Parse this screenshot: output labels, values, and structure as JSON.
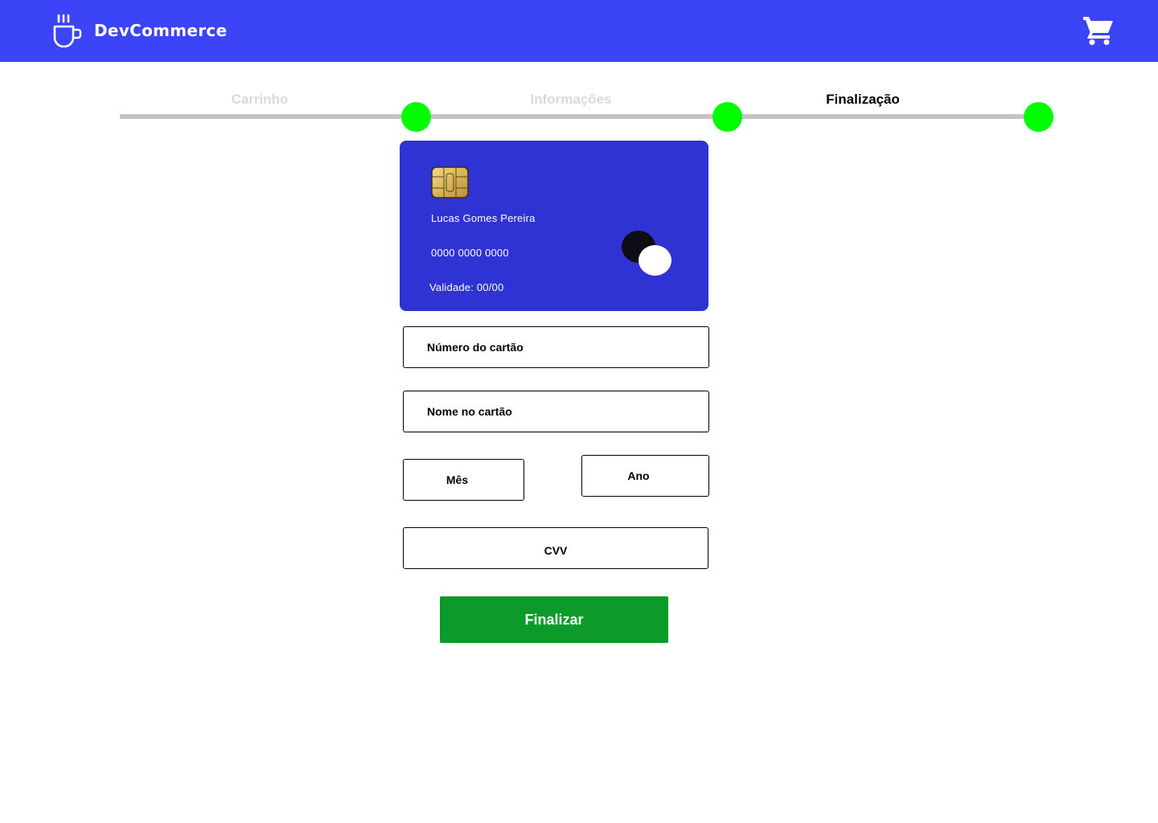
{
  "header": {
    "brand_name": "DevCommerce",
    "logo_icon": "coffee-cup-icon",
    "cart_icon": "shopping-cart-icon",
    "background_color": "#3c44f8"
  },
  "progress": {
    "steps": [
      {
        "label": "Carrinho",
        "state": "done"
      },
      {
        "label": "Informações",
        "state": "done"
      },
      {
        "label": "Finalização",
        "state": "current"
      }
    ],
    "dot_color": "#00ff00",
    "track_color": "#c4c4c4"
  },
  "card_preview": {
    "holder_name": "Lucas Gomes Pereira",
    "number": "0000 0000 0000",
    "expiry": "Validade: 00/00",
    "chip_icon": "card-chip-icon",
    "card_brand_icon": "card-brand-icon",
    "background_color": "#3033d3"
  },
  "form": {
    "card_number_placeholder": "Número do cartão",
    "card_name_placeholder": "Nome no cartão",
    "month_placeholder": "Mês",
    "year_placeholder": "Ano",
    "cvv_placeholder": "CVV"
  },
  "actions": {
    "finalize_label": "Finalizar",
    "finalize_color": "#0c9a28"
  }
}
